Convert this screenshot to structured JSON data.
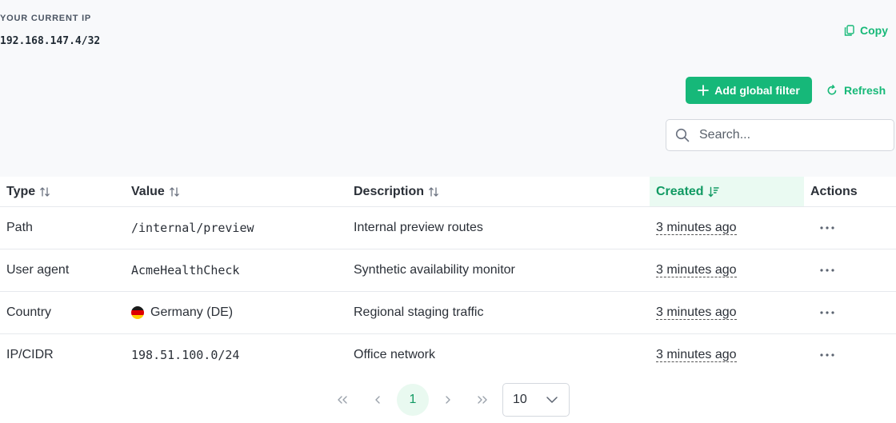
{
  "current_ip": {
    "label": "YOUR CURRENT IP",
    "value": "192.168.147.4/32",
    "copy_label": "Copy"
  },
  "toolbar": {
    "add_filter_label": "Add global filter",
    "refresh_label": "Refresh"
  },
  "search": {
    "placeholder": "Search..."
  },
  "table": {
    "headers": {
      "type": "Type",
      "value": "Value",
      "description": "Description",
      "created": "Created",
      "actions": "Actions"
    },
    "sorted_column": "created",
    "rows": [
      {
        "type": "Path",
        "value": "/internal/preview",
        "description": "Internal preview routes",
        "created": "3 minutes ago"
      },
      {
        "type": "User agent",
        "value": "AcmeHealthCheck",
        "description": "Synthetic availability monitor",
        "created": "3 minutes ago"
      },
      {
        "type": "Country",
        "value": "Germany (DE)",
        "value_icon": "germany-flag-icon",
        "description": "Regional staging traffic",
        "created": "3 minutes ago"
      },
      {
        "type": "IP/CIDR",
        "value": "198.51.100.0/24",
        "description": "Office network",
        "created": "3 minutes ago"
      }
    ]
  },
  "pagination": {
    "current_page": "1",
    "page_size": "10"
  },
  "colors": {
    "accent": "#16b879",
    "accent_text": "#119a63",
    "active_header_bg": "#eafaf2"
  }
}
